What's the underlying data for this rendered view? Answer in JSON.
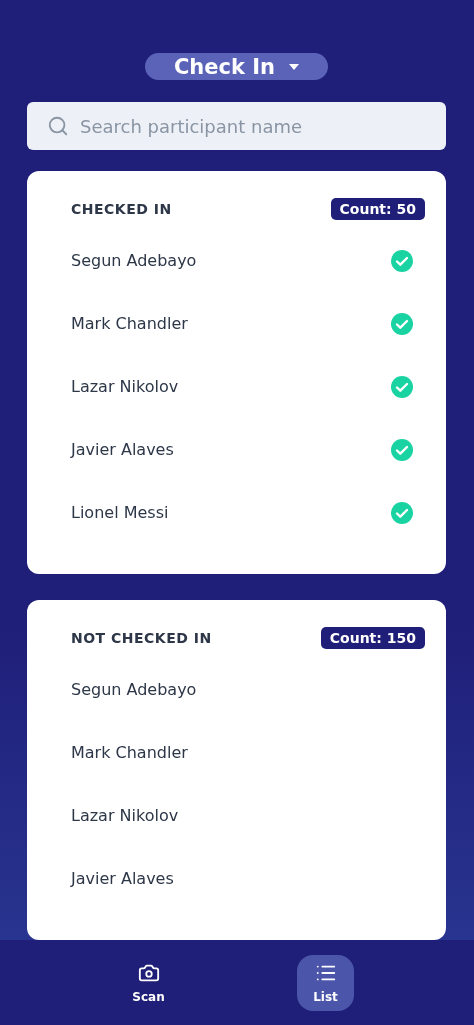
{
  "mode_button": {
    "label": "Check In"
  },
  "search": {
    "placeholder": "Search participant name"
  },
  "sections": [
    {
      "title": "CHECKED IN",
      "count": "Count: 50",
      "participants": [
        {
          "name": "Segun Adebayo",
          "checked": true
        },
        {
          "name": "Mark Chandler",
          "checked": true
        },
        {
          "name": "Lazar Nikolov",
          "checked": true
        },
        {
          "name": "Javier Alaves",
          "checked": true
        },
        {
          "name": "Lionel Messi",
          "checked": true
        }
      ]
    },
    {
      "title": "NOT CHECKED IN",
      "count": "Count: 150",
      "participants": [
        {
          "name": "Segun Adebayo",
          "checked": false
        },
        {
          "name": "Mark Chandler",
          "checked": false
        },
        {
          "name": "Lazar Nikolov",
          "checked": false
        },
        {
          "name": "Javier Alaves",
          "checked": false
        }
      ]
    }
  ],
  "nav": [
    {
      "label": "Scan",
      "kind": "camera",
      "selected": false
    },
    {
      "label": "List",
      "kind": "list",
      "selected": true
    }
  ]
}
